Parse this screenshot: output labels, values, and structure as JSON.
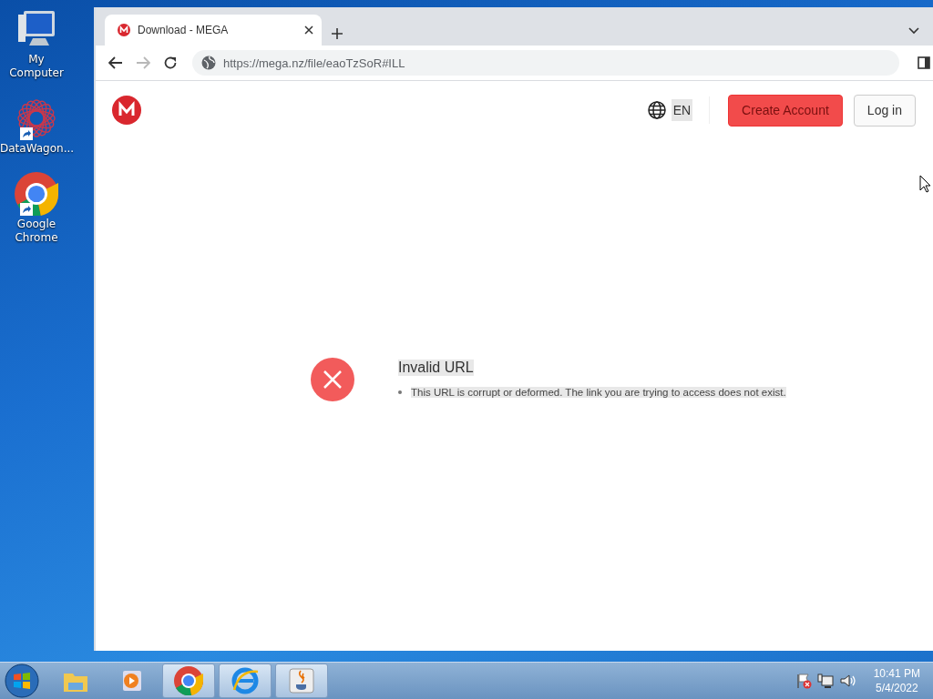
{
  "desktop_icons": [
    {
      "label": "My Computer",
      "kind": "computer"
    },
    {
      "label": "DataWagon...",
      "kind": "datawagon"
    },
    {
      "label": "Google Chrome",
      "kind": "chrome"
    }
  ],
  "browser": {
    "tabs": [
      {
        "title": "Download - MEGA",
        "selected": true
      }
    ],
    "url": "https://mega.nz/file/eaoTzSoR#ILL"
  },
  "page": {
    "language": "EN",
    "buttons": [
      {
        "label": "Create Account",
        "kind": "primary"
      },
      {
        "label": "Log in",
        "kind": "secondary"
      }
    ],
    "error": {
      "title": "Invalid URL",
      "items": [
        "This URL is corrupt or deformed. The link you are trying to access does not exist."
      ]
    }
  },
  "taskbar": {
    "apps": [
      {
        "kind": "explorer",
        "open": false
      },
      {
        "kind": "media",
        "open": false
      },
      {
        "kind": "chrome",
        "open": true
      },
      {
        "kind": "ie",
        "open": true
      },
      {
        "kind": "java",
        "open": true
      }
    ],
    "clock": {
      "time": "10:41 PM",
      "date": "5/4/2022"
    }
  }
}
